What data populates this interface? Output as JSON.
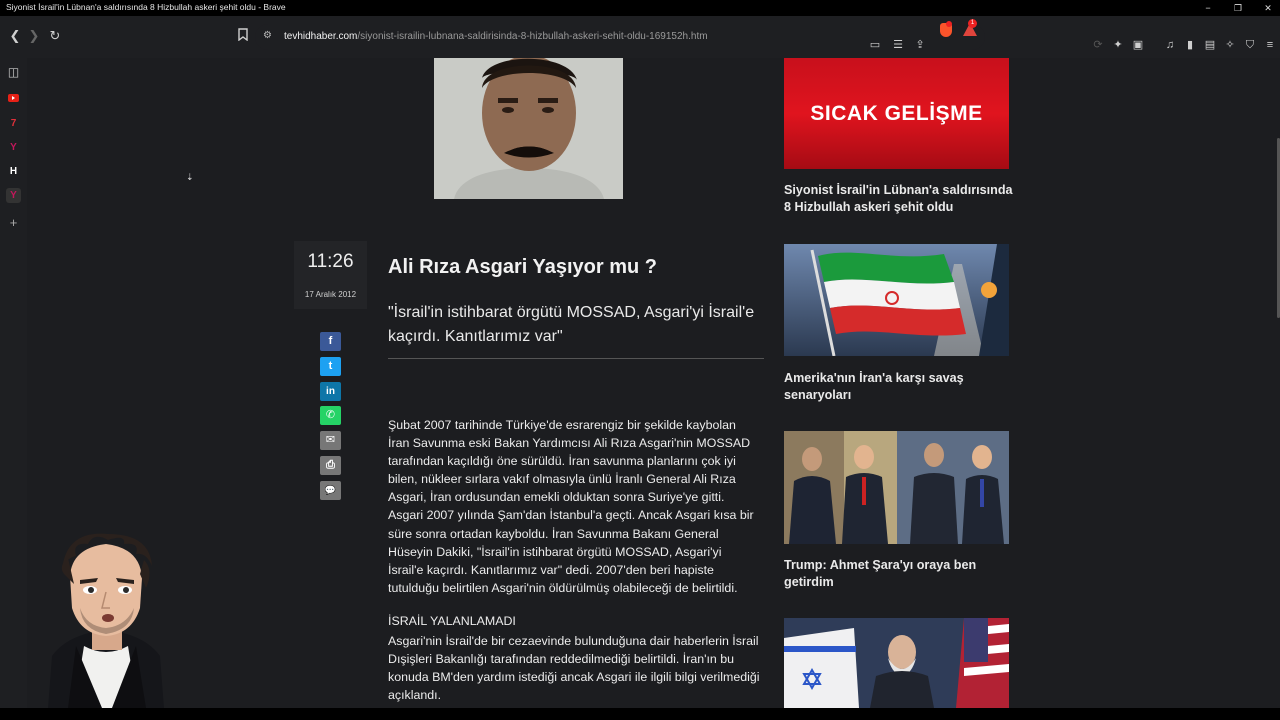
{
  "window": {
    "title": "Siyonist İsrail'in Lübnan'a saldırısında 8 Hizbullah askeri şehit oldu - Brave",
    "minimize": "−",
    "restore": "❐",
    "close": "✕"
  },
  "toolbar": {
    "url_host": "tevhidhaber.com",
    "url_path": "/siyonist-israilin-lubnana-saldirisinda-8-hizbullah-askeri-sehit-oldu-169152h.htm",
    "rewards_count": "1"
  },
  "article": {
    "time": "11:26",
    "date": "17 Aralık 2012",
    "title": "Ali Rıza Asgari Yaşıyor mu ?",
    "spot": "\"İsrail'in istihbarat örgütü MOSSAD, Asgari'yi İsrail'e kaçırdı. Kanıtlarımız var\"",
    "body": "Şubat 2007 tarihinde Türkiye'de esrarengiz bir şekilde kaybolan İran Savunma eski Bakan Yardımcısı Ali Rıza Asgari'nin MOSSAD tarafından kaçıldığı öne sürüldü. İran savunma planlarını çok iyi bilen, nükleer sırlara vakıf olmasıyla ünlü İranlı General Ali Rıza Asgari, İran ordusundan emekli olduktan sonra Suriye'ye gitti. Asgari 2007 yılında Şam'dan İstanbul'a geçti. Ancak Asgari kısa bir süre sonra ortadan kayboldu. İran Savunma Bakanı General Hüseyin Dakiki, \"İsrail'in istihbarat örgütü MOSSAD, Asgari'yi İsrail'e kaçırdı. Kanıtlarımız var\" dedi. 2007'den beri hapiste tutulduğu belirtilen Asgari'nin öldürülmüş olabileceği de belirtildi.",
    "subheading": "İSRAİL YALANLAMADI",
    "body2": "Asgari'nin İsrail'de bir cezaevinde bulunduğuna dair haberlerin İsrail Dışişleri Bakanlığı tarafından reddedilmediği belirtildi. İran'ın bu konuda BM'den yardım istediği ancak Asgari ile ilgili bilgi verilmediği açıklandı."
  },
  "share": {
    "facebook": "f",
    "twitter": "t",
    "linkedin": "in",
    "whatsapp": "✆",
    "email": "✉",
    "print": "⎙",
    "comment": "💬"
  },
  "sidebar_news": [
    {
      "image_text": "SICAK GELİŞME",
      "title": "Siyonist İsrail'in Lübnan'a saldırısında 8 Hizbullah askeri şehit oldu"
    },
    {
      "title": "Amerika'nın İran'a karşı savaş senaryoları"
    },
    {
      "title": "Trump: Ahmet Şara'yı oraya ben getirdim"
    },
    {
      "title": ""
    }
  ],
  "browser_sidebar": {
    "item2": "7",
    "item4": "H",
    "add": "+"
  },
  "colors": {
    "page_bg": "#1c1d20",
    "breaking_red": "#d7121c",
    "facebook": "#3b5998",
    "twitter": "#1da1f2",
    "linkedin": "#0e76a8",
    "whatsapp": "#25d366"
  }
}
